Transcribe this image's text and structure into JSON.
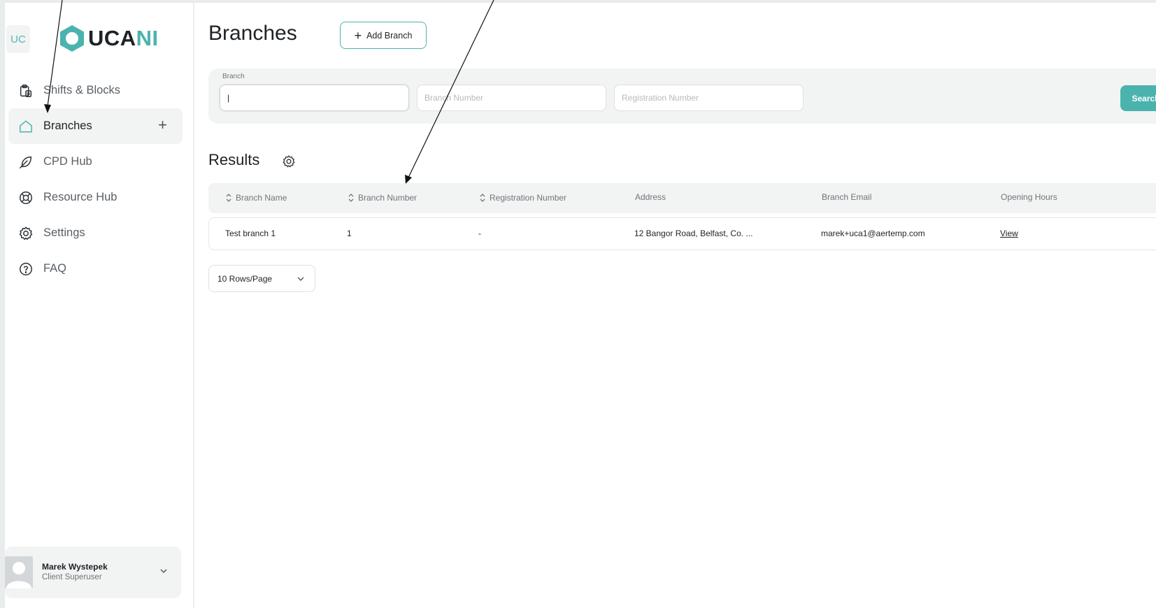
{
  "sidebar": {
    "badge": "UC",
    "logo": {
      "dark": "UCA",
      "teal": "NI"
    },
    "items": [
      {
        "label": "Shifts & Blocks",
        "icon": "clipboard-icon"
      },
      {
        "label": "Branches",
        "icon": "home-icon",
        "active": true,
        "action": "+"
      },
      {
        "label": "CPD Hub",
        "icon": "feather-icon"
      },
      {
        "label": "Resource Hub",
        "icon": "lifebuoy-icon"
      },
      {
        "label": "Settings",
        "icon": "gear-icon"
      },
      {
        "label": "FAQ",
        "icon": "help-circle-icon"
      }
    ],
    "user": {
      "name": "Marek Wystepek",
      "role": "Client Superuser"
    }
  },
  "header": {
    "title": "Branches",
    "add_label": "Add Branch"
  },
  "filters": {
    "branch_label": "Branch",
    "branch_value": "|",
    "branch_number_placeholder": "Branch Number",
    "registration_placeholder": "Registration Number",
    "search_label": "Search"
  },
  "results": {
    "title": "Results",
    "columns": [
      "Branch Name",
      "Branch Number",
      "Registration Number",
      "Address",
      "Branch Email",
      "Opening Hours"
    ],
    "rows": [
      {
        "name": "Test branch 1",
        "number": "1",
        "registration": "-",
        "address": "12 Bangor Road, Belfast, Co. ...",
        "email": "marek+uca1@aertemp.com",
        "hours": "View"
      }
    ],
    "rows_per_page": "10 Rows/Page"
  },
  "colors": {
    "accent": "#4bb3ad",
    "panel": "#f2f3f3",
    "text": "#1d2226"
  }
}
